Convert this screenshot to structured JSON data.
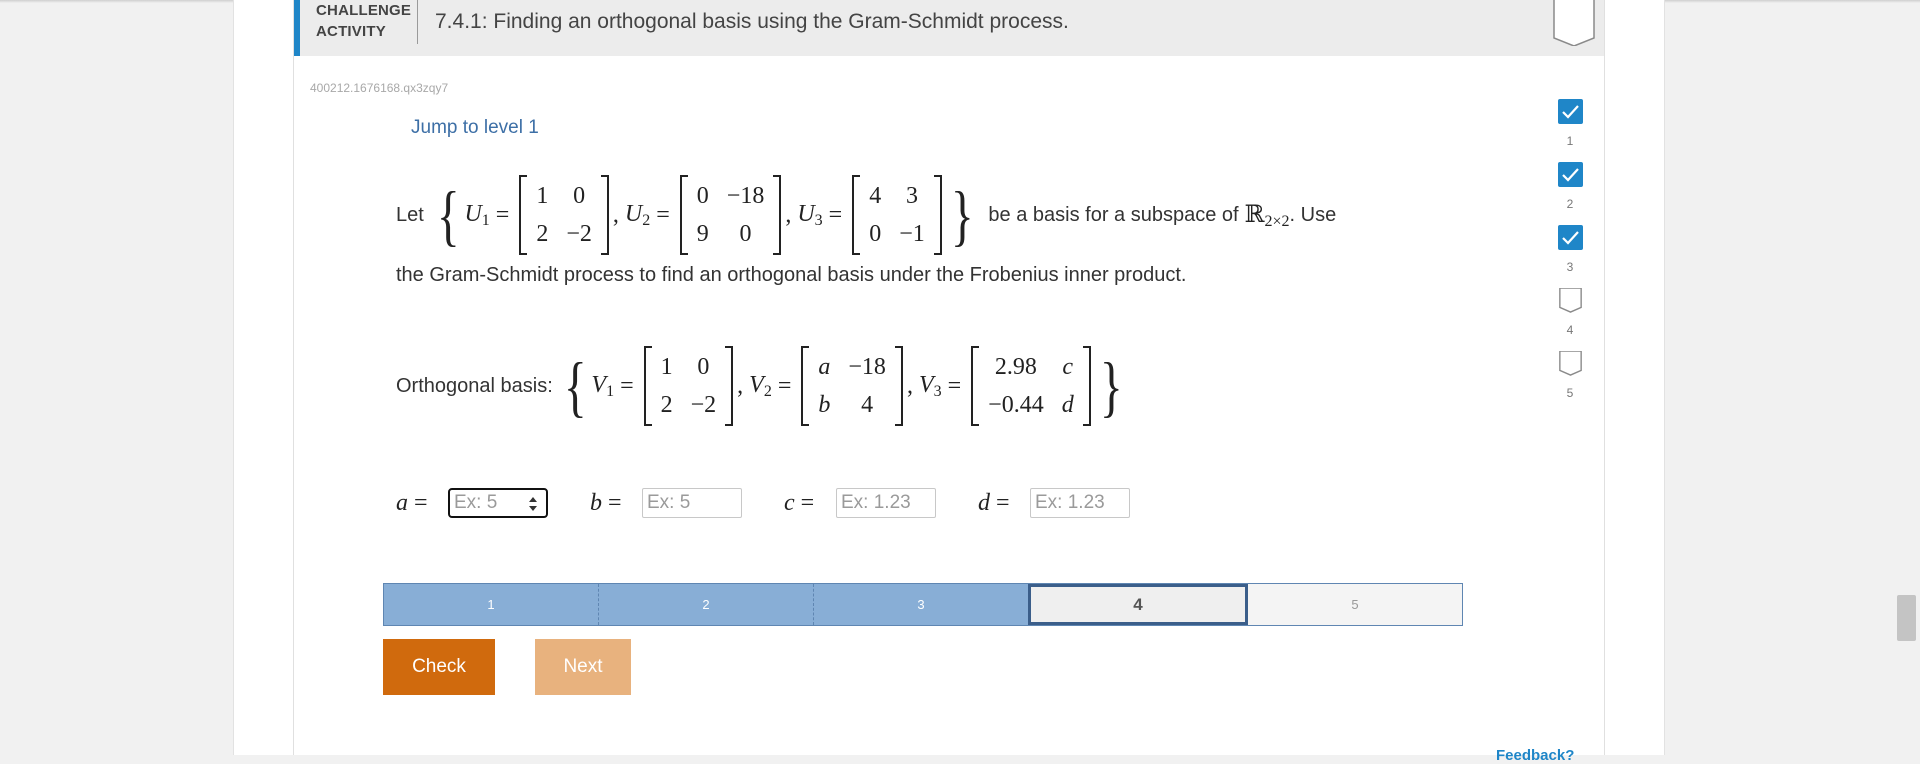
{
  "header": {
    "type_label": "CHALLENGE\nACTIVITY",
    "title": "7.4.1: Finding an orthogonal basis using the Gram-Schmidt process."
  },
  "activity_id": "400212.1676168.qx3zqy7",
  "jump_link": "Jump to level 1",
  "problem": {
    "let": "Let",
    "U1": {
      "name": "U",
      "sub": "1",
      "rows": [
        [
          "1",
          "0"
        ],
        [
          "2",
          "−2"
        ]
      ]
    },
    "U2": {
      "name": "U",
      "sub": "2",
      "rows": [
        [
          "0",
          "−18"
        ],
        [
          "9",
          "0"
        ]
      ]
    },
    "U3": {
      "name": "U",
      "sub": "3",
      "rows": [
        [
          "4",
          "3"
        ],
        [
          "0",
          "−1"
        ]
      ]
    },
    "mid_text": "be a basis for a subspace of",
    "space": "ℝ",
    "space_sub": "2×2",
    "end_text": ". Use",
    "line2": "the Gram-Schmidt process to find an orthogonal basis under the Frobenius inner product."
  },
  "orthogonal": {
    "label": "Orthogonal basis:",
    "V1": {
      "name": "V",
      "sub": "1",
      "rows": [
        [
          "1",
          "0"
        ],
        [
          "2",
          "−2"
        ]
      ]
    },
    "V2": {
      "name": "V",
      "sub": "2",
      "rows": [
        [
          "a",
          "−18"
        ],
        [
          "b",
          "4"
        ]
      ]
    },
    "V3": {
      "name": "V",
      "sub": "3",
      "rows": [
        [
          "2.98",
          "c"
        ],
        [
          "−0.44",
          "d"
        ]
      ]
    }
  },
  "answers": [
    {
      "var": "a",
      "placeholder": "Ex: 5"
    },
    {
      "var": "b",
      "placeholder": "Ex: 5"
    },
    {
      "var": "c",
      "placeholder": "Ex: 1.23"
    },
    {
      "var": "d",
      "placeholder": "Ex: 1.23"
    }
  ],
  "levels": [
    "1",
    "2",
    "3",
    "4",
    "5"
  ],
  "current_level": "4",
  "buttons": {
    "check": "Check",
    "next": "Next"
  },
  "feedback": "Feedback?",
  "progress_steps": [
    {
      "num": "1",
      "done": true
    },
    {
      "num": "2",
      "done": true
    },
    {
      "num": "3",
      "done": true
    },
    {
      "num": "4",
      "done": false
    },
    {
      "num": "5",
      "done": false
    }
  ],
  "colors": {
    "accent": "#1f86c8",
    "check": "#d06a0d",
    "next": "#e8b27e",
    "level_done": "#88aed6"
  }
}
